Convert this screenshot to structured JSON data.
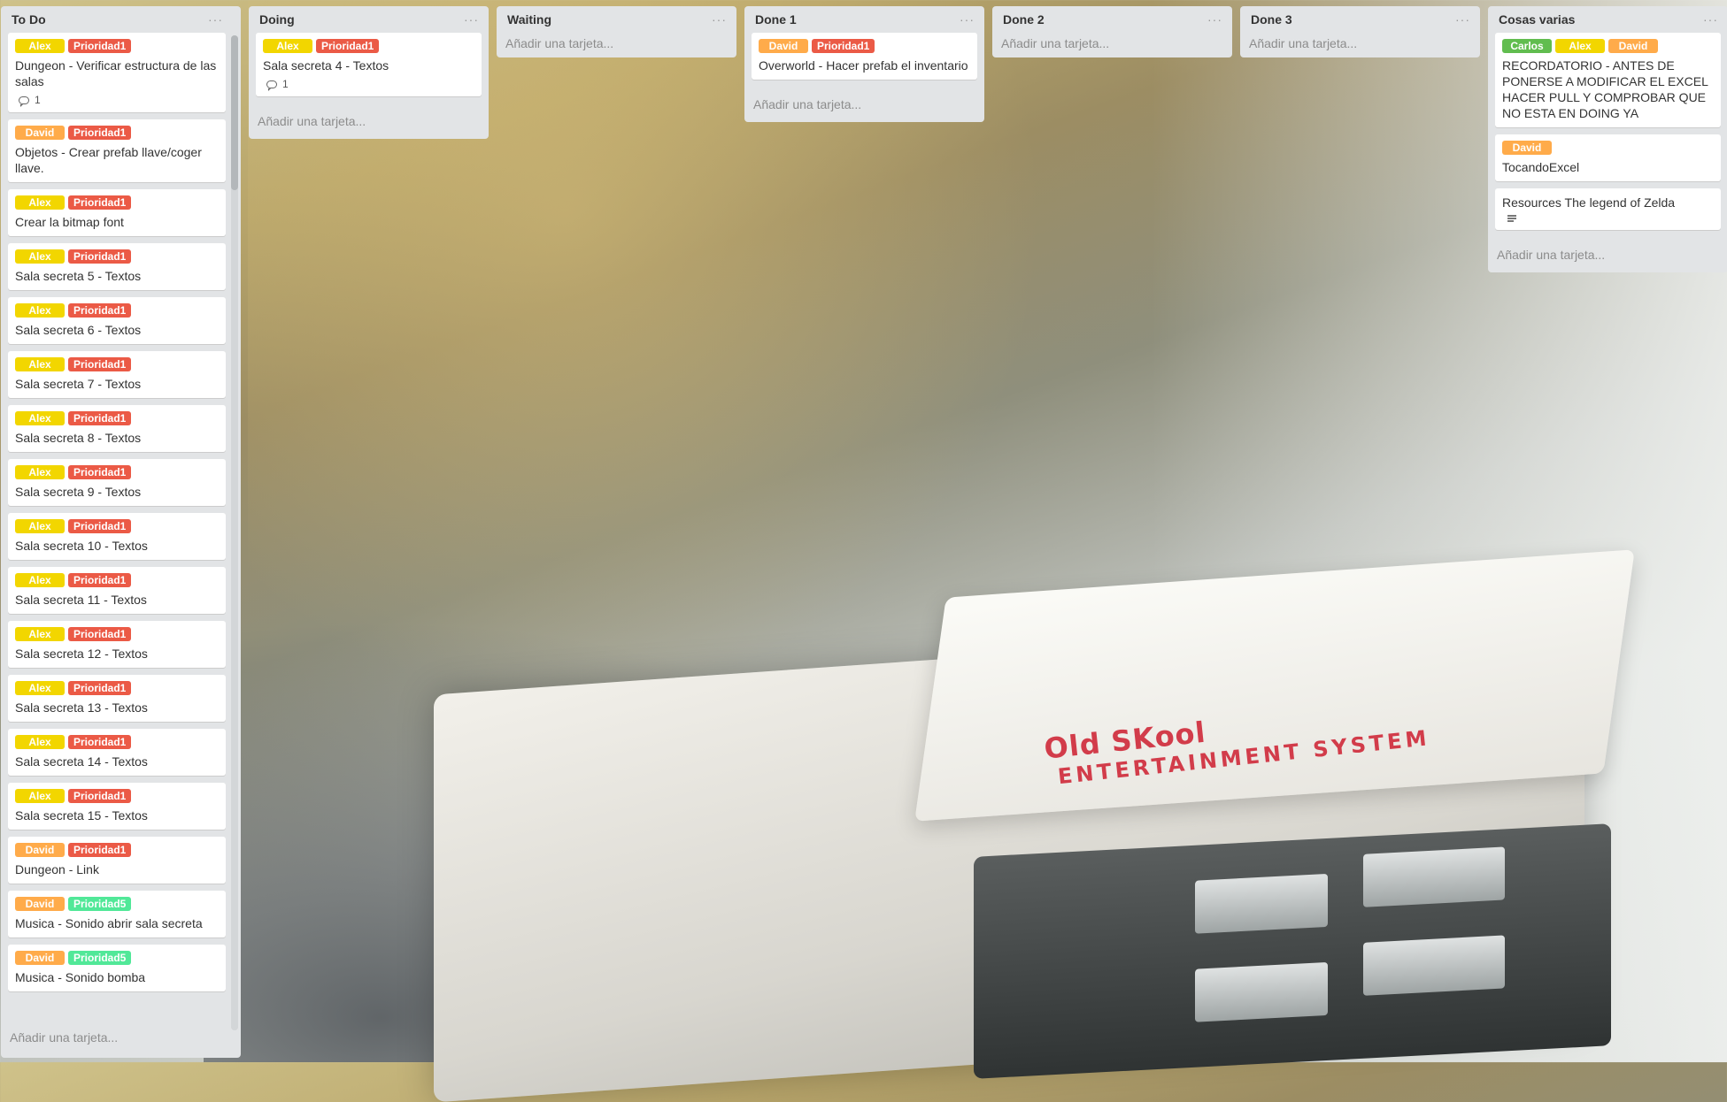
{
  "colors": {
    "list_bg": "#e2e4e6",
    "alex": "#f2d600",
    "david": "#ffab4a",
    "carlos": "#61bd4f",
    "prioridad1": "#eb5a46",
    "prioridad5": "#51e898"
  },
  "background_logo": {
    "line1": "Old SKool",
    "line2": "ENTERTAINMENT SYSTEM"
  },
  "lists": [
    {
      "title": "To Do",
      "add_label": "Añadir una tarjeta...",
      "cards": [
        {
          "labels": [
            {
              "text": "Alex",
              "color": "#f2d600"
            },
            {
              "text": "Prioridad1",
              "color": "#eb5a46"
            }
          ],
          "title": "Dungeon - Verificar estructura de las salas",
          "comments": "1"
        },
        {
          "labels": [
            {
              "text": "David",
              "color": "#ffab4a"
            },
            {
              "text": "Prioridad1",
              "color": "#eb5a46"
            }
          ],
          "title": "Objetos - Crear prefab llave/coger llave."
        },
        {
          "labels": [
            {
              "text": "Alex",
              "color": "#f2d600"
            },
            {
              "text": "Prioridad1",
              "color": "#eb5a46"
            }
          ],
          "title": "Crear la bitmap font"
        },
        {
          "labels": [
            {
              "text": "Alex",
              "color": "#f2d600"
            },
            {
              "text": "Prioridad1",
              "color": "#eb5a46"
            }
          ],
          "title": "Sala secreta 5 - Textos"
        },
        {
          "labels": [
            {
              "text": "Alex",
              "color": "#f2d600"
            },
            {
              "text": "Prioridad1",
              "color": "#eb5a46"
            }
          ],
          "title": "Sala secreta 6 - Textos"
        },
        {
          "labels": [
            {
              "text": "Alex",
              "color": "#f2d600"
            },
            {
              "text": "Prioridad1",
              "color": "#eb5a46"
            }
          ],
          "title": "Sala secreta 7 - Textos"
        },
        {
          "labels": [
            {
              "text": "Alex",
              "color": "#f2d600"
            },
            {
              "text": "Prioridad1",
              "color": "#eb5a46"
            }
          ],
          "title": "Sala secreta 8 - Textos"
        },
        {
          "labels": [
            {
              "text": "Alex",
              "color": "#f2d600"
            },
            {
              "text": "Prioridad1",
              "color": "#eb5a46"
            }
          ],
          "title": "Sala secreta 9 - Textos"
        },
        {
          "labels": [
            {
              "text": "Alex",
              "color": "#f2d600"
            },
            {
              "text": "Prioridad1",
              "color": "#eb5a46"
            }
          ],
          "title": "Sala secreta 10 - Textos"
        },
        {
          "labels": [
            {
              "text": "Alex",
              "color": "#f2d600"
            },
            {
              "text": "Prioridad1",
              "color": "#eb5a46"
            }
          ],
          "title": "Sala secreta 11 - Textos"
        },
        {
          "labels": [
            {
              "text": "Alex",
              "color": "#f2d600"
            },
            {
              "text": "Prioridad1",
              "color": "#eb5a46"
            }
          ],
          "title": "Sala secreta 12 - Textos"
        },
        {
          "labels": [
            {
              "text": "Alex",
              "color": "#f2d600"
            },
            {
              "text": "Prioridad1",
              "color": "#eb5a46"
            }
          ],
          "title": "Sala secreta 13 - Textos"
        },
        {
          "labels": [
            {
              "text": "Alex",
              "color": "#f2d600"
            },
            {
              "text": "Prioridad1",
              "color": "#eb5a46"
            }
          ],
          "title": "Sala secreta 14 - Textos"
        },
        {
          "labels": [
            {
              "text": "Alex",
              "color": "#f2d600"
            },
            {
              "text": "Prioridad1",
              "color": "#eb5a46"
            }
          ],
          "title": "Sala secreta 15 - Textos"
        },
        {
          "labels": [
            {
              "text": "David",
              "color": "#ffab4a"
            },
            {
              "text": "Prioridad1",
              "color": "#eb5a46"
            }
          ],
          "title": "Dungeon - Link"
        },
        {
          "labels": [
            {
              "text": "David",
              "color": "#ffab4a"
            },
            {
              "text": "Prioridad5",
              "color": "#51e898"
            }
          ],
          "title": "Musica - Sonido abrir sala secreta"
        },
        {
          "labels": [
            {
              "text": "David",
              "color": "#ffab4a"
            },
            {
              "text": "Prioridad5",
              "color": "#51e898"
            }
          ],
          "title": "Musica - Sonido bomba"
        }
      ]
    },
    {
      "title": "Doing",
      "add_label": "Añadir una tarjeta...",
      "cards": [
        {
          "labels": [
            {
              "text": "Alex",
              "color": "#f2d600"
            },
            {
              "text": "Prioridad1",
              "color": "#eb5a46"
            }
          ],
          "title": "Sala secreta 4 - Textos",
          "comments": "1"
        }
      ]
    },
    {
      "title": "Waiting",
      "add_label": "Añadir una tarjeta...",
      "cards": []
    },
    {
      "title": "Done 1",
      "add_label": "Añadir una tarjeta...",
      "cards": [
        {
          "labels": [
            {
              "text": "David",
              "color": "#ffab4a"
            },
            {
              "text": "Prioridad1",
              "color": "#eb5a46"
            }
          ],
          "title": "Overworld - Hacer prefab el inventario"
        }
      ]
    },
    {
      "title": "Done 2",
      "add_label": "Añadir una tarjeta...",
      "cards": []
    },
    {
      "title": "Done 3",
      "add_label": "Añadir una tarjeta...",
      "cards": []
    },
    {
      "title": "Cosas varias",
      "add_label": "Añadir una tarjeta...",
      "cards": [
        {
          "labels": [
            {
              "text": "Carlos",
              "color": "#61bd4f"
            },
            {
              "text": "Alex",
              "color": "#f2d600"
            },
            {
              "text": "David",
              "color": "#ffab4a"
            }
          ],
          "title": "RECORDATORIO - ANTES DE PONERSE A MODIFICAR EL EXCEL HACER PULL Y COMPROBAR QUE NO ESTA EN DOING YA"
        },
        {
          "labels": [
            {
              "text": "David",
              "color": "#ffab4a"
            }
          ],
          "title": "TocandoExcel"
        },
        {
          "labels": [],
          "title": "Resources The legend of Zelda",
          "description": true
        }
      ]
    }
  ],
  "list_menu_icon": "ellipsis-icon"
}
